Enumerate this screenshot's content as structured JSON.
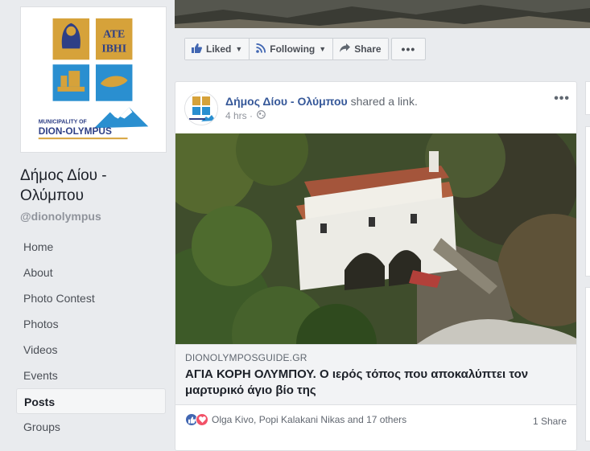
{
  "page": {
    "name": "Δήμος Δίου - Ολύμπου",
    "handle": "@dionolympus",
    "logo_text": [
      "ΑΤΕ",
      "ΙΒΗΙ",
      "MUNICIPALITY OF",
      "DION-OLYMPUS"
    ]
  },
  "nav": {
    "items": [
      {
        "label": "Home",
        "icon": "home"
      },
      {
        "label": "About",
        "icon": "about"
      },
      {
        "label": "Photo Contest",
        "icon": "contest"
      },
      {
        "label": "Photos",
        "icon": "photos"
      },
      {
        "label": "Videos",
        "icon": "videos"
      },
      {
        "label": "Events",
        "icon": "events"
      },
      {
        "label": "Posts",
        "icon": "posts",
        "active": true
      },
      {
        "label": "Groups",
        "icon": "groups"
      }
    ]
  },
  "actions": {
    "liked": "Liked",
    "following": "Following",
    "share": "Share",
    "more": "•••"
  },
  "post": {
    "author": "Δήμος Δίου - Ολύμπου",
    "action": "shared a link.",
    "time": "4 hrs",
    "menu": "•••",
    "link": {
      "domain": "DIONOLYMPOSGUIDE.GR",
      "title": "ΑΓΙΑ ΚΟΡΗ ΟΛΥΜΠΟΥ. Ο ιερός τόπος που αποκαλύπτει τον μαρτυρικό άγιο βίο της"
    },
    "reactions": {
      "names": "Olga Kivo, Popi Kalakani Nikas and 17 others",
      "share_count": "1 Share",
      "types": [
        "like",
        "love"
      ]
    }
  },
  "colors": {
    "brand_blue": "#365899",
    "like_blue": "#4267b2",
    "love_red": "#f25268",
    "page_bg": "#e9ebee"
  }
}
